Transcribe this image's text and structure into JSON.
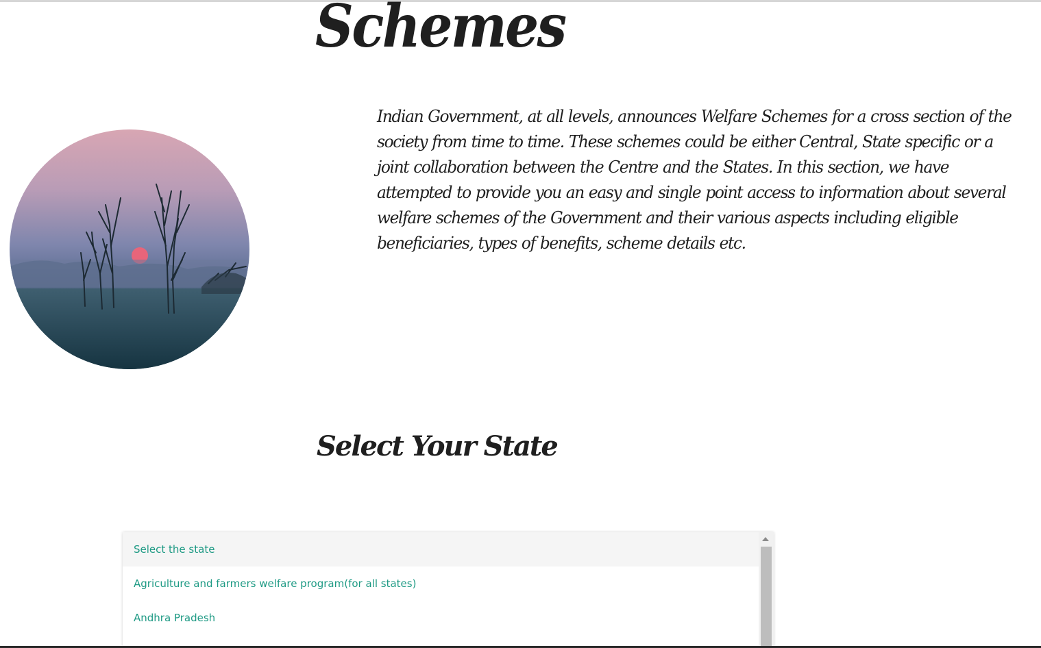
{
  "page": {
    "title": "Schemes",
    "image_alt": "Misty sunrise over field with bare trees"
  },
  "intro": {
    "text": "Indian Government, at all levels, announces Welfare Schemes for a cross section of the society from time to time. These schemes could be either Central, State specific or a joint collaboration between the Centre and the States. In this section, we have attempted to provide you an easy and single point access to information about several welfare schemes of the Government and their various aspects including eligible beneficiaries, types of benefits, scheme details etc."
  },
  "state_selector": {
    "heading": "Select Your State",
    "options": [
      "Select the state",
      "Agriculture and farmers welfare program(for all states)",
      "Andhra Pradesh"
    ],
    "selected_index": 0
  },
  "colors": {
    "option_text": "#1e9a84",
    "heading_text": "#1f1f1f",
    "selected_option_bg": "#f5f5f5"
  }
}
